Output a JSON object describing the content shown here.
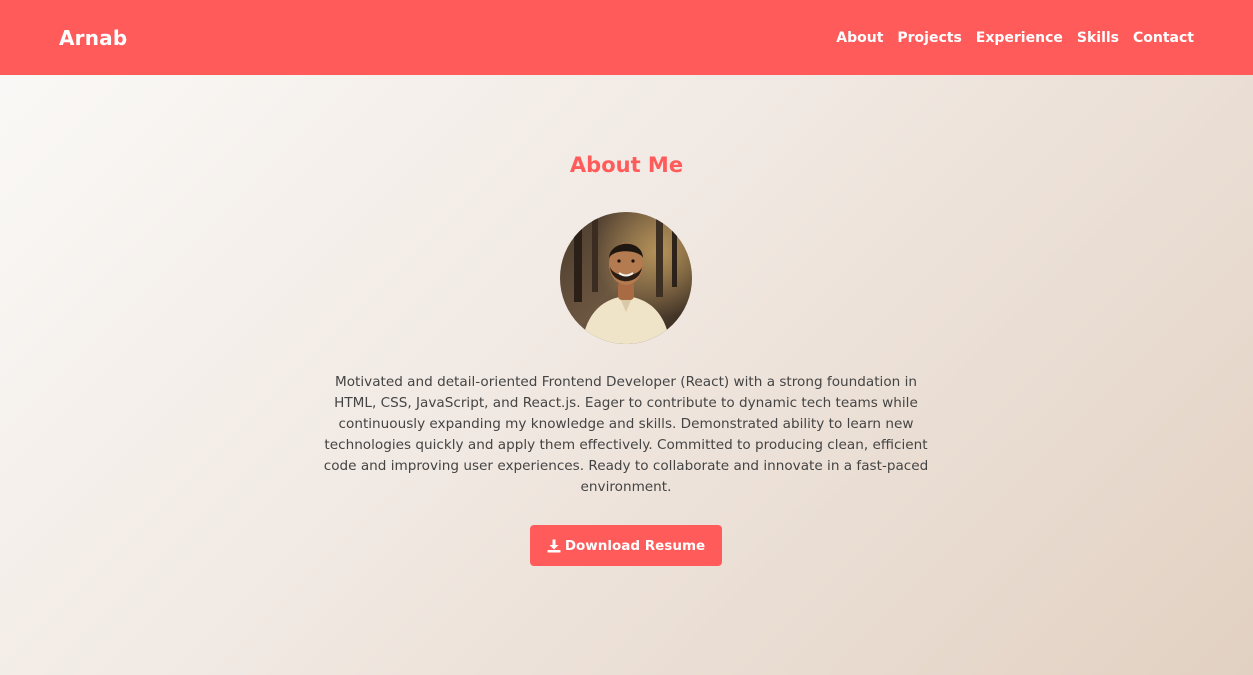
{
  "navbar": {
    "brand": "Arnab",
    "links": [
      "About",
      "Projects",
      "Experience",
      "Skills",
      "Contact"
    ]
  },
  "about": {
    "title": "About Me",
    "description": "Motivated and detail-oriented Frontend Developer (React) with a strong foundation in HTML, CSS, JavaScript, and React.js. Eager to contribute to dynamic tech teams while continuously expanding my knowledge and skills. Demonstrated ability to learn new technologies quickly and apply them effectively. Committed to producing clean, efficient code and improving user experiences. Ready to collaborate and innovate in a fast-paced environment.",
    "download_label": "Download Resume",
    "download_icon": "download-icon"
  },
  "colors": {
    "accent": "#ff5b5b",
    "text": "#444444"
  }
}
